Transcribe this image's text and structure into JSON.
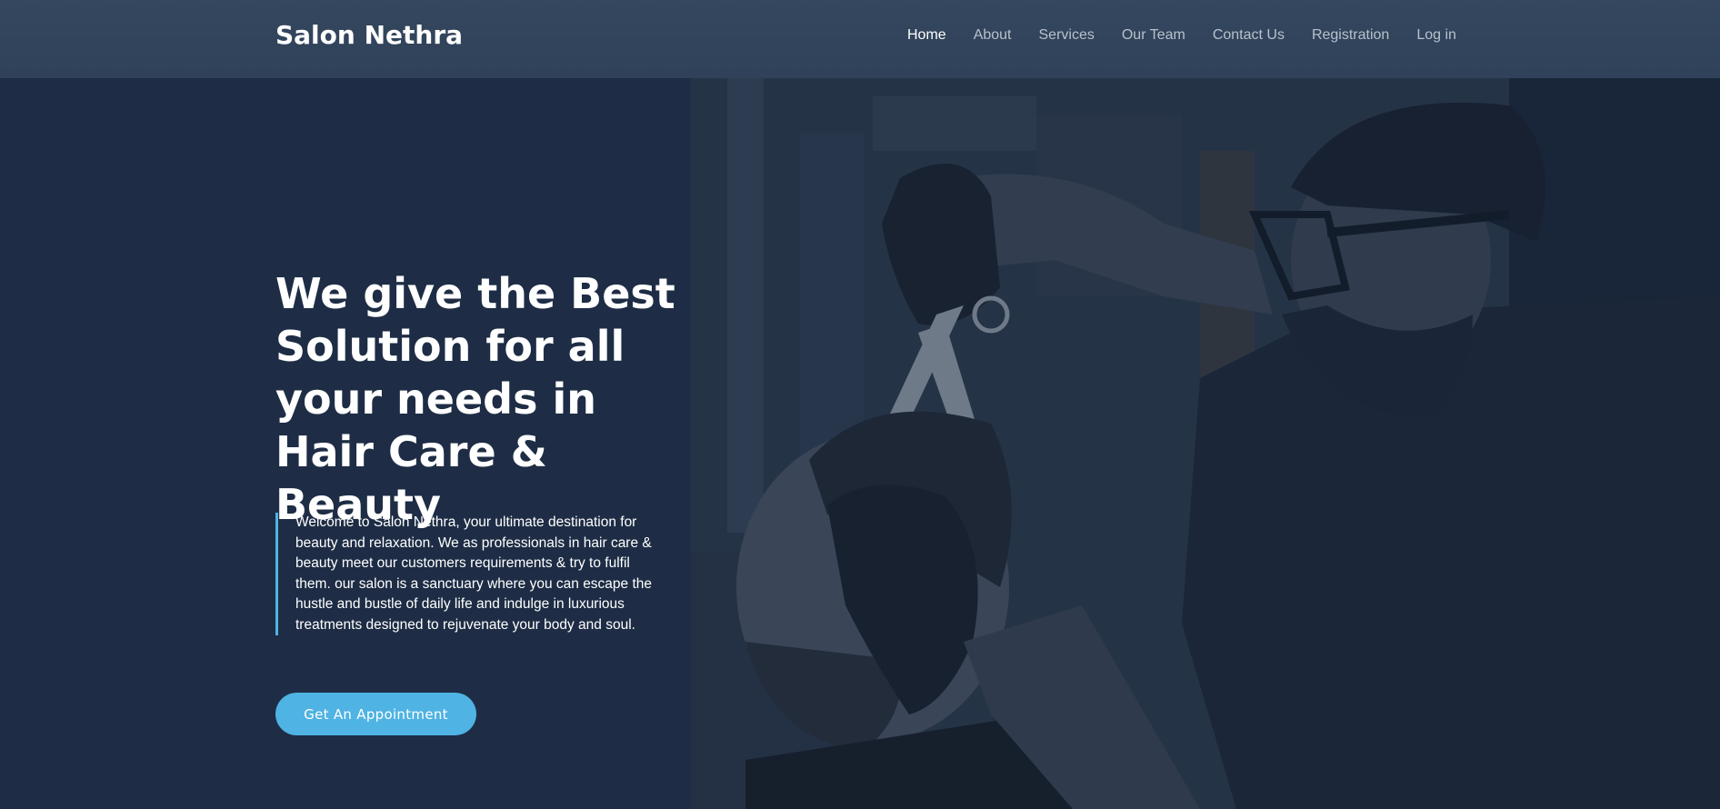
{
  "nav": {
    "brand": "Salon Nethra",
    "links": [
      {
        "label": "Home",
        "active": true
      },
      {
        "label": "About",
        "active": false
      },
      {
        "label": "Services",
        "active": false
      },
      {
        "label": "Our Team",
        "active": false
      },
      {
        "label": "Contact Us",
        "active": false
      },
      {
        "label": "Registration",
        "active": false
      },
      {
        "label": "Log in",
        "active": false
      }
    ]
  },
  "hero": {
    "title": "We give the Best Solution for all your needs in Hair Care & Beauty",
    "description": "Welcome to Salon Nethra, your ultimate destination for beauty and relaxation. We as professionals in hair care & beauty meet our customers requirements & try to fulfil them. our salon is a sanctuary where you can escape the hustle and bustle of daily life and indulge in luxurious treatments designed to rejuvenate your body and soul.",
    "cta_label": "Get An Appointment",
    "image_alt": "barber-cutting-hair-photo"
  },
  "colors": {
    "background": "#1e2d45",
    "navbar": "#34475f",
    "accent": "#4fb3e3",
    "nav_text": "#b8c1cc",
    "text": "#ffffff"
  }
}
